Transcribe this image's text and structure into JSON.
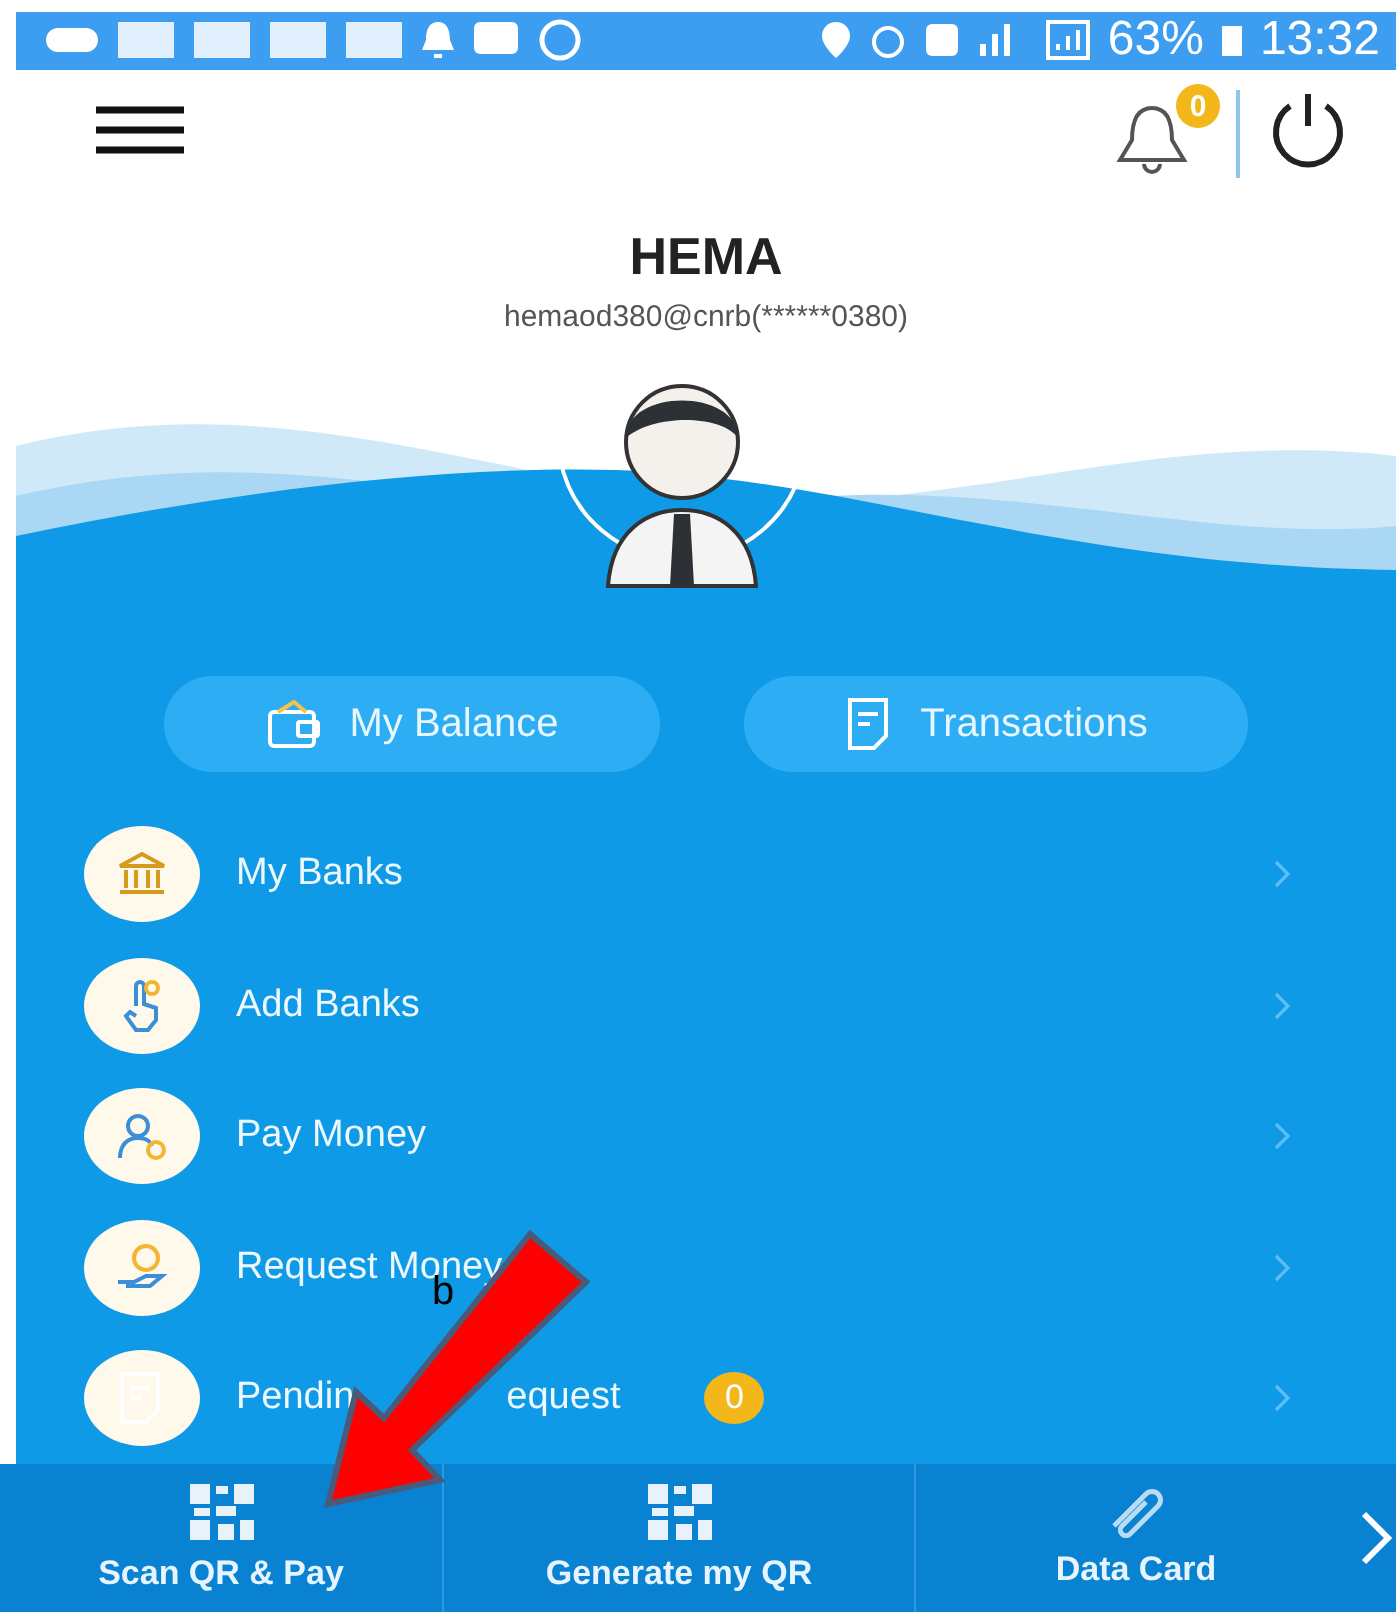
{
  "status_bar": {
    "battery": "63%",
    "time": "13:32"
  },
  "header": {
    "notification_count": "0"
  },
  "profile": {
    "name": "HEMA",
    "account": "hemaod380@cnrb(******0380)"
  },
  "quick_actions": [
    {
      "label": "My Balance",
      "kind": "wallet"
    },
    {
      "label": "Transactions",
      "kind": "document"
    }
  ],
  "menu": [
    {
      "label": "My Banks",
      "kind": "bank"
    },
    {
      "label": "Add Banks",
      "kind": "hand"
    },
    {
      "label": "Pay Money",
      "kind": "person"
    },
    {
      "label": "Request Money",
      "kind": "coin"
    },
    {
      "label": "Pendin",
      "label_after_arrow": "equest",
      "kind": "document",
      "badge": "0"
    }
  ],
  "bottom_nav": [
    {
      "label": "Scan QR & Pay",
      "kind": "qr"
    },
    {
      "label": "Generate my QR",
      "kind": "qr"
    },
    {
      "label": "Data Card",
      "kind": "clip"
    }
  ],
  "annotation": {
    "label": "b"
  }
}
